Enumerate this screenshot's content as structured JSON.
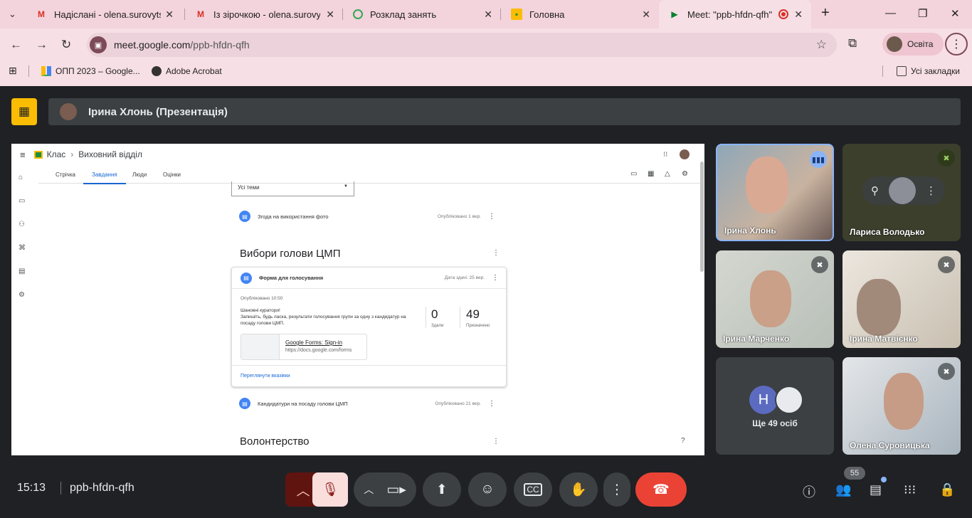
{
  "browser": {
    "tabs": [
      {
        "title": "Надіслані - olena.surovytska",
        "icon": "gmail-icon",
        "active": false
      },
      {
        "title": "Із зірочкою - olena.surovyts",
        "icon": "gmail-icon",
        "active": false
      },
      {
        "title": "Розклад занять",
        "icon": "site-icon",
        "active": false
      },
      {
        "title": "Головна",
        "icon": "classroom-icon",
        "active": false
      },
      {
        "title": "Meet: \"ppb-hfdn-qfh\"",
        "icon": "meet-icon",
        "active": true
      }
    ],
    "url_host": "meet.google.com",
    "url_path": "/ppb-hfdn-qfh",
    "profile_label": "Освіта",
    "bookmarks": [
      {
        "label": "ОПП 2023 – Google..."
      },
      {
        "label": "Adobe Acrobat"
      }
    ],
    "all_bookmarks": "Усі закладки"
  },
  "meet": {
    "presenter_name": "Ірина Хлонь (Презентація)",
    "accent_color": "#fbbc04",
    "participants": [
      {
        "name": "Ірина Хлонь",
        "speaking": true
      },
      {
        "name": "Лариса Володько",
        "speaking": false
      },
      {
        "name": "Ірина Марченко",
        "speaking": false
      },
      {
        "name": "Ірина Матвієнко",
        "speaking": false
      },
      {
        "name": "Ще 49 осіб",
        "initial": "H",
        "speaking": false
      },
      {
        "name": "Олена Суровицька",
        "speaking": false
      }
    ],
    "time": "15:13",
    "meeting_code": "ppb-hfdn-qfh",
    "participant_count": "55"
  },
  "classroom": {
    "breadcrumb_root": "Клас",
    "breadcrumb_current": "Виховний відділ",
    "tabs": [
      "Стрічка",
      "Завдання",
      "Люди",
      "Оцінки"
    ],
    "topic_filter": "Усі теми",
    "items": [
      {
        "title": "Згода на використання фото",
        "meta": "Опубліковано 1 вер."
      },
      {
        "title": "Кандидатури на посаду голови ЦМП",
        "meta": "Опубліковано 21 вер."
      }
    ],
    "section1": "Вибори голови ЦМП",
    "section2": "Волонтерство",
    "card": {
      "title": "Форма для голосування",
      "due": "Дата здачі: 25 вер.",
      "published": "Опубліковано 10:50",
      "desc_line1": "Шановні куратори!",
      "desc_line2": "Запишіть, будь ласка, результати голосування групи за одну з кандидатур на посаду голови ЦМП.",
      "handed_in": "0",
      "handed_in_label": "Здали",
      "assigned": "49",
      "assigned_label": "Призначено",
      "attachment_title": "Google Forms: Sign-in",
      "attachment_url": "https://docs.google.com/forms",
      "view_link": "Переглянути вказівки"
    }
  }
}
